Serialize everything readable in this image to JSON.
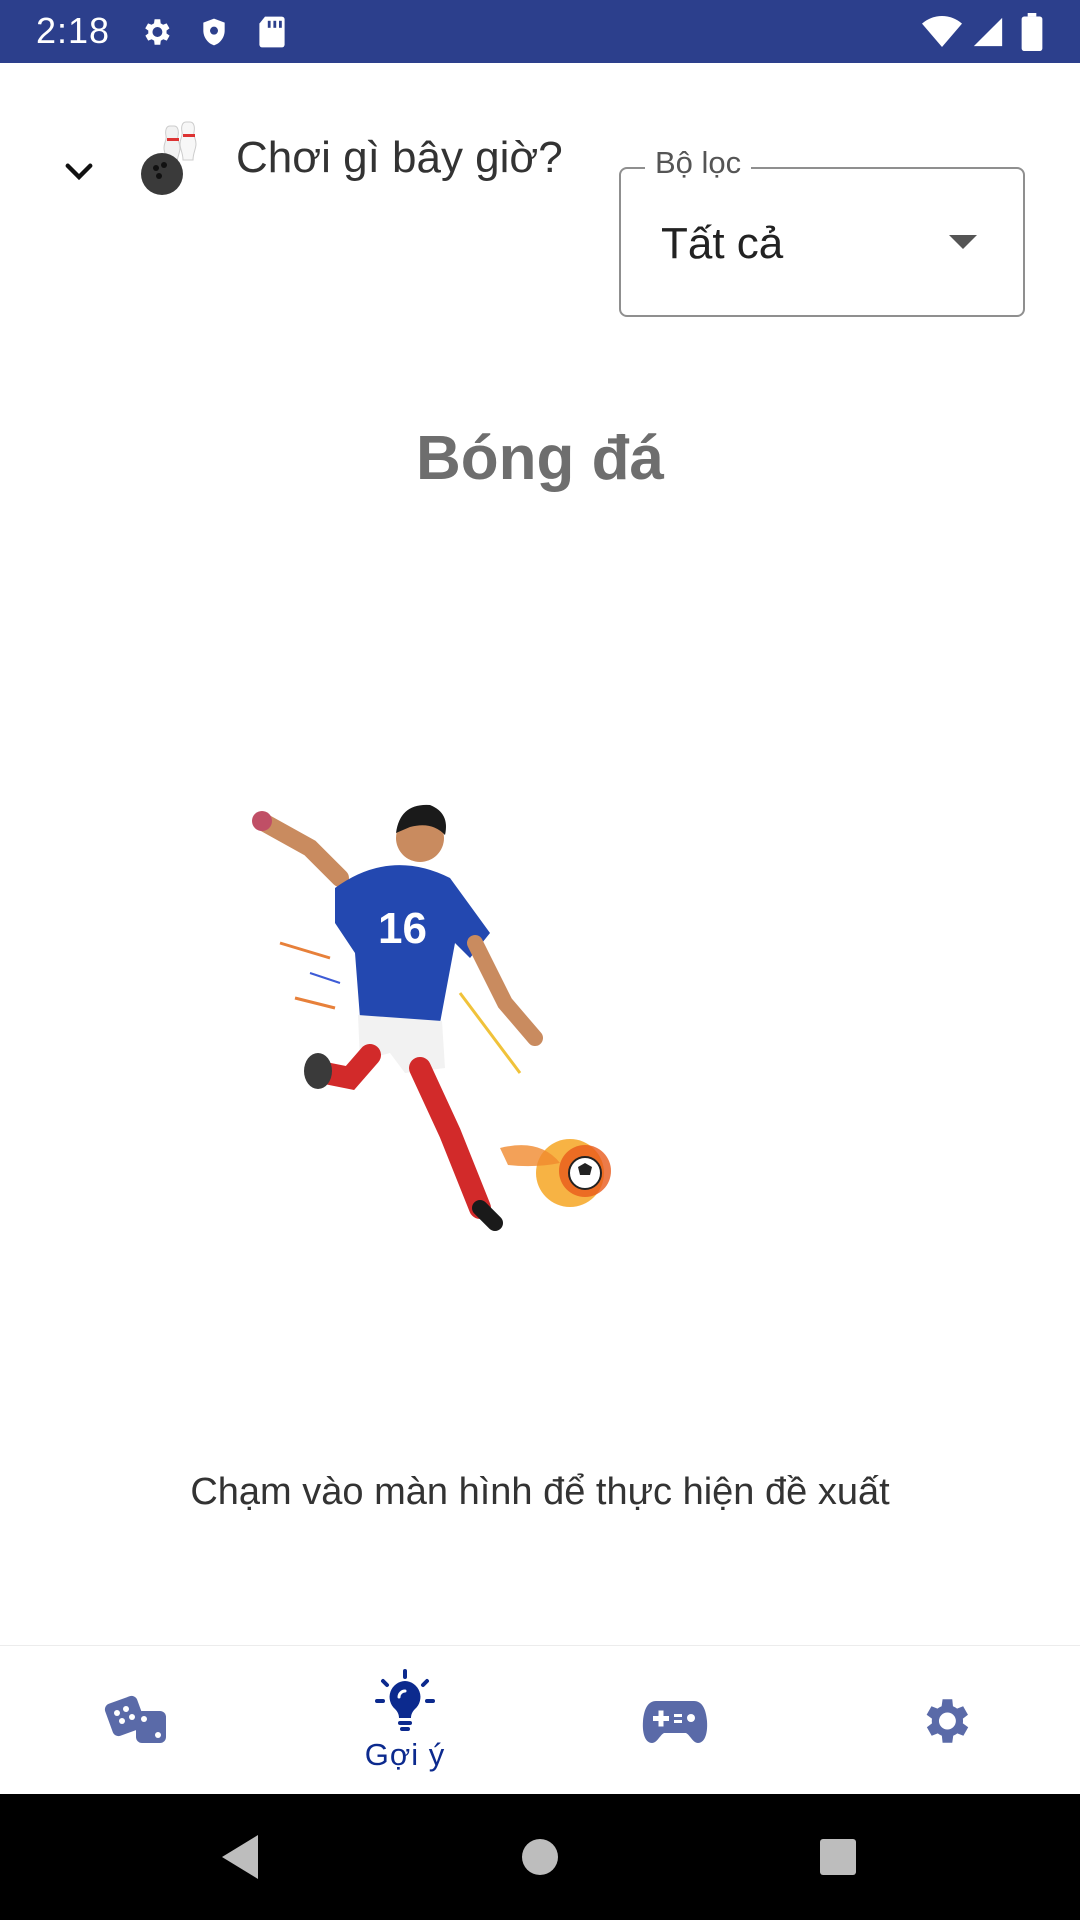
{
  "status_bar": {
    "time": "2:18",
    "icons_left": [
      "settings-icon",
      "shield-icon",
      "sd-card-icon"
    ],
    "icons_right": [
      "wifi-icon",
      "signal-icon",
      "battery-icon"
    ]
  },
  "header": {
    "title": "Chơi gì bây giờ?",
    "emoji_icon": "bowling-icon",
    "filter": {
      "label": "Bộ lọc",
      "value": "Tất cả"
    }
  },
  "suggestion": {
    "name": "Bóng đá",
    "image": "soccer-player-illustration",
    "hint": "Chạm vào màn hình để thực hiện đề xuất"
  },
  "bottom_nav": {
    "items": [
      {
        "icon": "dice-icon",
        "label": ""
      },
      {
        "icon": "lightbulb-icon",
        "label": "Gợi ý",
        "active": true
      },
      {
        "icon": "gamepad-icon",
        "label": ""
      },
      {
        "icon": "settings-icon",
        "label": ""
      }
    ]
  },
  "colors": {
    "status_bar": "#2c3f8c",
    "accent": "#0c2a8e",
    "nav_icon": "#5a6aa8"
  }
}
